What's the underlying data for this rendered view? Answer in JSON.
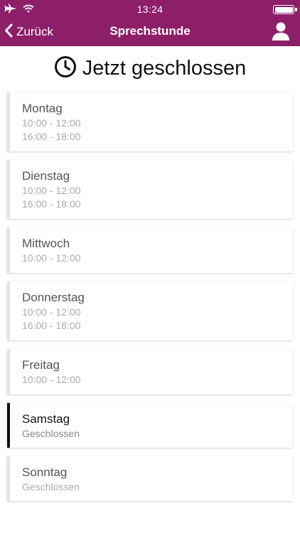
{
  "status_bar": {
    "time": "13:24"
  },
  "nav": {
    "back_label": "Zurück",
    "title": "Sprechstunde",
    "back_icon": "chevron-left-icon",
    "user_icon": "user-icon"
  },
  "page": {
    "title": "Jetzt geschlossen",
    "title_icon": "clock-icon"
  },
  "colors": {
    "brand": "#8c1f68",
    "active_border": "#111111",
    "inactive_border": "#e3e3e3"
  },
  "days": [
    {
      "name": "Montag",
      "times": [
        "10:00 - 12:00",
        "16:00 - 18:00"
      ],
      "active": false
    },
    {
      "name": "Dienstag",
      "times": [
        "10:00 - 12:00",
        "16:00 - 18:00"
      ],
      "active": false
    },
    {
      "name": "Mittwoch",
      "times": [
        "10:00 - 12:00"
      ],
      "active": false
    },
    {
      "name": "Donnerstag",
      "times": [
        "10:00 - 12:00",
        "16:00 - 18:00"
      ],
      "active": false
    },
    {
      "name": "Freitag",
      "times": [
        "10:00 - 12:00"
      ],
      "active": false
    },
    {
      "name": "Samstag",
      "times": [
        "Geschlossen"
      ],
      "active": true
    },
    {
      "name": "Sonntag",
      "times": [
        "Geschlossen"
      ],
      "active": false
    }
  ]
}
